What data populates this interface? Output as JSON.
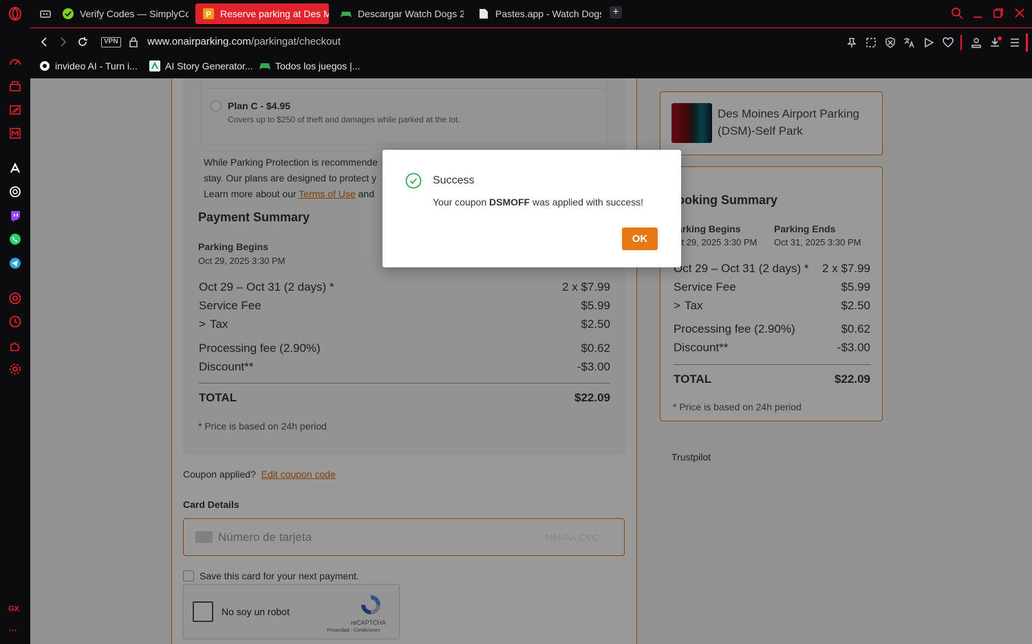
{
  "browser": {
    "tabs": [
      {
        "label": "Verify Codes — SimplyCo",
        "active": false
      },
      {
        "label": "Reserve parking at Des M",
        "active": true
      },
      {
        "label": "Descargar Watch Dogs 2",
        "active": false
      },
      {
        "label": "Pastes.app - Watch Dogs",
        "active": false
      }
    ],
    "new_tab": "+",
    "vpn": "VPN",
    "url_host": "www.onairparking.com",
    "url_path": "/parkingat/checkout",
    "bookmarks": [
      "invideo AI - Turn i...",
      "AI Story Generator...",
      "Todos los juegos |..."
    ],
    "sidebar_gx": "GX",
    "sidebar_more": "···"
  },
  "page": {
    "plan_c_title": "Plan C - $4.95",
    "plan_c_desc": "Covers up to $250 of theft and damages while parked at the lot.",
    "protection_line1": "While Parking Protection is recommende",
    "protection_line2": "stay. Our plans are designed to protect y",
    "protection_line3_pre": "Learn more about our",
    "terms_link": "Terms of Use",
    "protection_line3_post": "and",
    "payment_summary_title": "Payment Summary",
    "parking_begins_label": "Parking Begins",
    "parking_begins_value": "Oct 29, 2025 3:30 PM",
    "lines": [
      {
        "label": "Oct 29 – Oct 31 (2 days) *",
        "value": "2 x $7.99"
      },
      {
        "label": "Service Fee",
        "value": "$5.99"
      },
      {
        "label": "Tax",
        "value": "$2.50"
      },
      {
        "label": "Processing fee (2.90%)",
        "value": "$0.62"
      },
      {
        "label": "Discount**",
        "value": "-$3.00"
      }
    ],
    "total_label": "TOTAL",
    "total_value": "$22.09",
    "price_note": "* Price is based on 24h period",
    "coupon_applied": "Coupon applied?",
    "edit_coupon": "Edit coupon code",
    "card_details": "Card Details",
    "card_placeholder": "Número de tarjeta",
    "card_hint": "MM/AA  CVC",
    "save_card": "Save this card for your next payment.",
    "captcha_label": "No soy un robot",
    "captcha_brand": "reCAPTCHA",
    "captcha_links": "Privacidad - Condiciones"
  },
  "sidebar_summary": {
    "lot_name_line1": "Des Moines Airport Parking",
    "lot_name_line2": "(DSM)-Self Park",
    "booking_title": "ooking Summary",
    "begins_label": "arking Begins",
    "begins_value": "ct 29, 2025 3:30 PM",
    "ends_label": "Parking Ends",
    "ends_value": "Oct 31, 2025 3:30 PM",
    "lines": [
      {
        "label": "Oct 29 – Oct 31 (2 days) *",
        "value": "2 x $7.99"
      },
      {
        "label": "Service Fee",
        "value": "$5.99"
      },
      {
        "label": "Tax",
        "value": "$2.50"
      },
      {
        "label": "Processing fee (2.90%)",
        "value": "$0.62"
      },
      {
        "label": "Discount**",
        "value": "-$3.00"
      }
    ],
    "total_label": "TOTAL",
    "total_value": "$22.09",
    "price_note": "* Price is based on 24h period",
    "trustpilot": "Trustpilot"
  },
  "modal": {
    "title": "Success",
    "msg_pre": "Your coupon ",
    "coupon": "DSMOFF",
    "msg_post": " was applied with success!",
    "ok": "OK"
  },
  "colors": {
    "accent": "#e87813",
    "browser_red": "#e0232c",
    "success_green": "#3aa657"
  }
}
